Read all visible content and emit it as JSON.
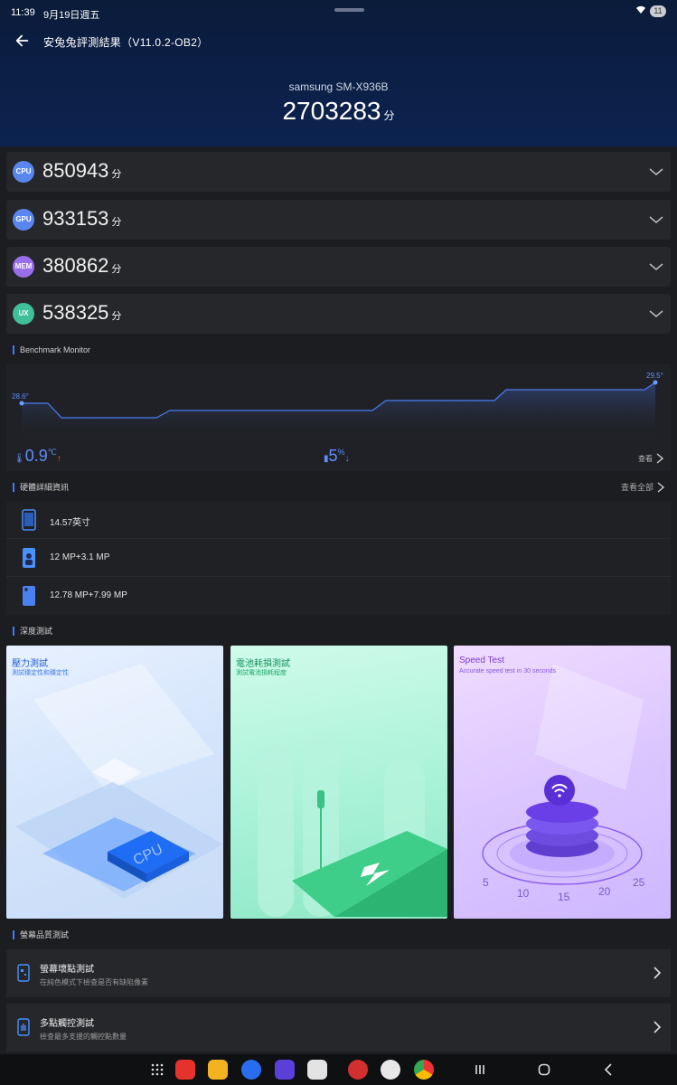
{
  "status_bar": {
    "time": "11:39",
    "date": "9月19日週五",
    "battery": "11"
  },
  "header": {
    "title": "安兔兔評測結果（V11.0.2-OB2）",
    "device": "samsung SM-X936B",
    "total_score": "2703283",
    "score_unit": "分"
  },
  "scores": [
    {
      "badge": "CPU",
      "value": "850943",
      "unit": "分",
      "color": "#5a86f0"
    },
    {
      "badge": "GPU",
      "value": "933153",
      "unit": "分",
      "color": "#5a86f0"
    },
    {
      "badge": "MEM",
      "value": "380862",
      "unit": "分",
      "color": "#9a6ee8"
    },
    {
      "badge": "UX",
      "value": "538325",
      "unit": "分",
      "color": "#3fbf9a"
    }
  ],
  "benchmark_monitor": {
    "label": "Benchmark Monitor",
    "start_temp": "28.6°",
    "end_temp": "29.5°",
    "temp_rise": "0.9",
    "temp_unit": "℃",
    "battery_drop": "5",
    "battery_unit": "%",
    "detail_label": "查看"
  },
  "hardware": {
    "label": "硬體詳細資訊",
    "more": "查看全部",
    "items": [
      {
        "icon": "phone-screen-icon",
        "text": "14.57英寸"
      },
      {
        "icon": "front-camera-icon",
        "text": "12 MP+3.1 MP"
      },
      {
        "icon": "rear-camera-icon",
        "text": "12.78 MP+7.99 MP"
      }
    ]
  },
  "deep_test": {
    "label": "深度測試",
    "cards": [
      {
        "title": "壓力測試",
        "subtitle": "測試穩定性和穩定性",
        "scene_text": "CPU"
      },
      {
        "title": "電池耗損測試",
        "subtitle": "測試電池損耗程度"
      },
      {
        "title": "Speed Test",
        "subtitle": "Accurate speed test in 30 seconds",
        "ticks": [
          "5",
          "10",
          "15",
          "20",
          "25"
        ]
      }
    ]
  },
  "screen_test": {
    "label": "螢幕品質測試",
    "items": [
      {
        "title": "螢幕壞點測試",
        "subtitle": "在純色模式下檢查是否有缺陷像素"
      },
      {
        "title": "多點觸控測試",
        "subtitle": "檢查最多支援的觸控點數量"
      }
    ]
  },
  "taskbar": {
    "apps": [
      "apps-grid-icon",
      "notes-app-icon",
      "files-app-icon",
      "messages-app-icon",
      "browser-app-icon",
      "camera-app-icon",
      "antutu-app-icon",
      "antutu-3d-app-icon",
      "chrome-app-icon"
    ],
    "nav": [
      "recents-button",
      "home-button",
      "back-nav-button"
    ]
  }
}
